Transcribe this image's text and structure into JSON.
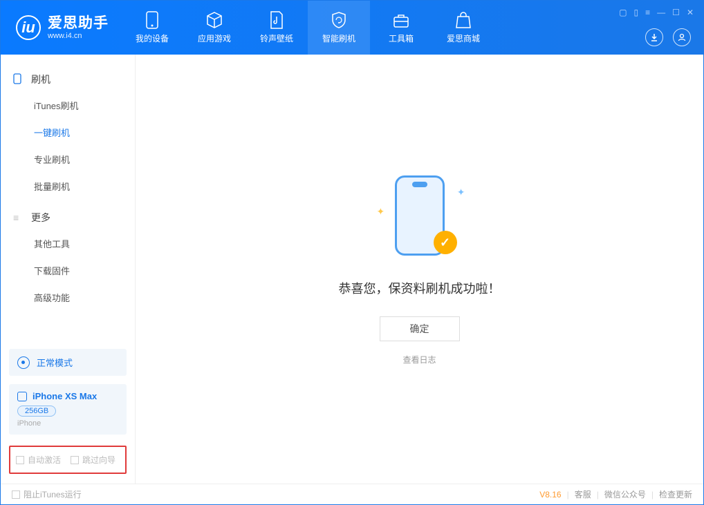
{
  "app": {
    "title": "爱思助手",
    "subtitle": "www.i4.cn"
  },
  "nav": {
    "items": [
      {
        "label": "我的设备"
      },
      {
        "label": "应用游戏"
      },
      {
        "label": "铃声壁纸"
      },
      {
        "label": "智能刷机"
      },
      {
        "label": "工具箱"
      },
      {
        "label": "爱思商城"
      }
    ]
  },
  "sidebar": {
    "section1_title": "刷机",
    "section1_items": [
      "iTunes刷机",
      "一键刷机",
      "专业刷机",
      "批量刷机"
    ],
    "section2_title": "更多",
    "section2_items": [
      "其他工具",
      "下载固件",
      "高级功能"
    ],
    "mode_label": "正常模式",
    "device_name": "iPhone XS Max",
    "device_storage": "256GB",
    "device_type": "iPhone",
    "opt_auto_activate": "自动激活",
    "opt_skip_wizard": "跳过向导"
  },
  "main": {
    "success_text": "恭喜您，保资料刷机成功啦！",
    "ok_button": "确定",
    "view_log": "查看日志"
  },
  "footer": {
    "block_itunes": "阻止iTunes运行",
    "version": "V8.16",
    "support": "客服",
    "wechat": "微信公众号",
    "check_update": "检查更新"
  }
}
